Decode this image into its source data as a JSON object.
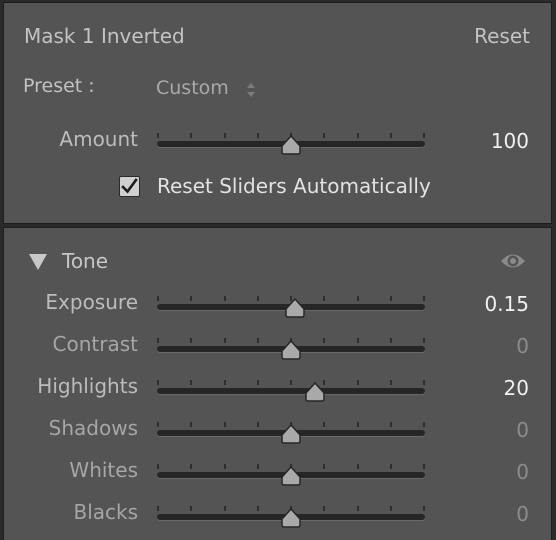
{
  "mask_panel": {
    "title": "Mask 1 Inverted",
    "reset_label": "Reset",
    "preset_label": "Preset :",
    "preset_value": "Custom",
    "amount": {
      "label": "Amount",
      "value": "100",
      "position": 0.5
    },
    "reset_sliders_label": "Reset Sliders Automatically",
    "reset_sliders_checked": true
  },
  "tone_section": {
    "label": "Tone",
    "sliders": [
      {
        "label": "Exposure",
        "value": "0.15",
        "position": 0.515,
        "highlight": true
      },
      {
        "label": "Contrast",
        "value": "0",
        "position": 0.5,
        "highlight": false
      },
      {
        "label": "Highlights",
        "value": "20",
        "position": 0.59,
        "highlight": true
      },
      {
        "label": "Shadows",
        "value": "0",
        "position": 0.5,
        "highlight": false
      },
      {
        "label": "Whites",
        "value": "0",
        "position": 0.5,
        "highlight": false
      },
      {
        "label": "Blacks",
        "value": "0",
        "position": 0.5,
        "highlight": false
      }
    ]
  },
  "icons": {
    "collapse": "triangle-down-icon",
    "visibility": "eye-icon",
    "preset_dropdown": "updown-arrows-icon",
    "checkbox": "checkmark-icon"
  },
  "colors": {
    "panel": "#545454",
    "value_active": "#f0f0f0",
    "value_inactive": "#8c8c8c",
    "label_active": "#bcbcbc",
    "label_inactive": "#a6a6a6"
  }
}
